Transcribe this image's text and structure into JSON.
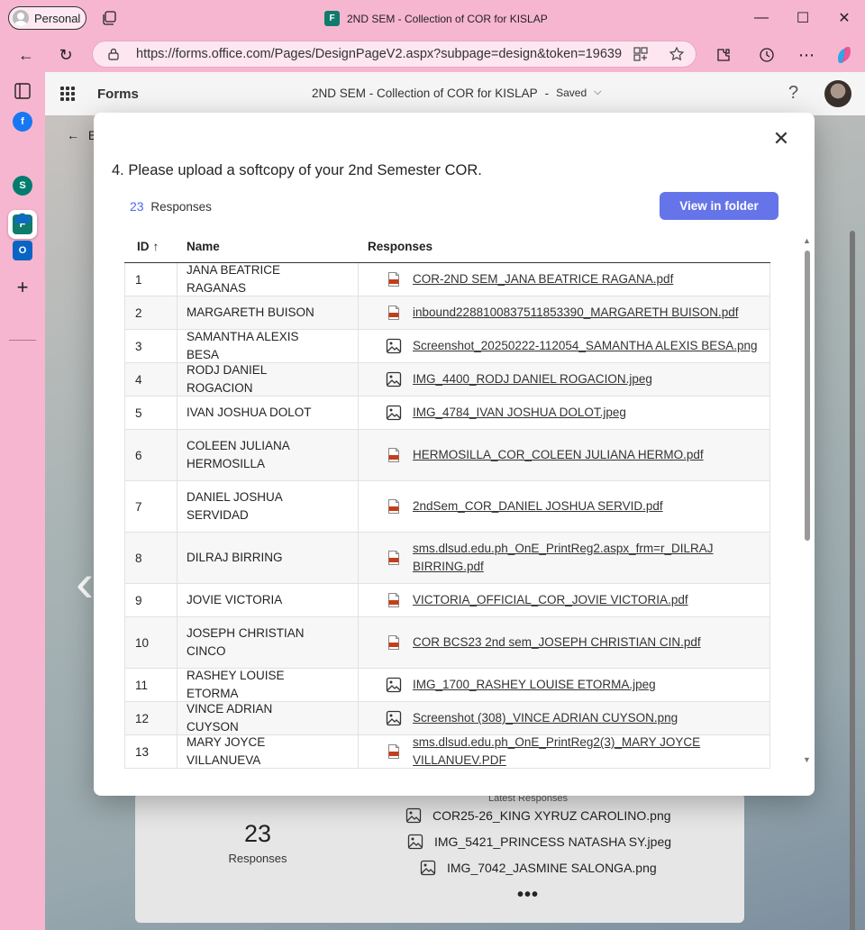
{
  "browser": {
    "profile_label": "Personal",
    "window_title": "2ND SEM - Collection of COR for KISLAP",
    "url": "https://forms.office.com/Pages/DesignPageV2.aspx?subpage=design&token=19639..."
  },
  "forms_header": {
    "app_name": "Forms",
    "doc_title": "2ND SEM - Collection of COR for KISLAP",
    "separator": "-",
    "save_status": "Saved",
    "help_label": "?"
  },
  "background": {
    "back_label": "B",
    "summary": {
      "count": "23",
      "count_label": "Responses",
      "latest_label": "Latest Responses",
      "latest": [
        {
          "file": "COR25-26_KING XYRUZ CAROLINO.png"
        },
        {
          "file": "IMG_5421_PRINCESS NATASHA SY.jpeg"
        },
        {
          "file": "IMG_7042_JASMINE SALONGA.png"
        }
      ],
      "more": "•••"
    }
  },
  "modal": {
    "question": "4. Please upload a softcopy of your 2nd Semester COR.",
    "response_count": "23",
    "response_label": "Responses",
    "view_folder_label": "View in folder",
    "columns": {
      "id": "ID",
      "id_sort": "↑",
      "name": "Name",
      "responses": "Responses"
    },
    "rows": [
      {
        "id": "1",
        "name": "JANA BEATRICE RAGANAS",
        "file": "COR-2ND SEM_JANA BEATRICE RAGANA.pdf",
        "type": "pdf"
      },
      {
        "id": "2",
        "name": "MARGARETH BUISON",
        "file": "inbound2288100837511853390_MARGARETH BUISON.pdf",
        "type": "pdf"
      },
      {
        "id": "3",
        "name": "SAMANTHA ALEXIS BESA",
        "file": "Screenshot_20250222-112054_SAMANTHA ALEXIS BESA.png",
        "type": "image"
      },
      {
        "id": "4",
        "name": "RODJ DANIEL ROGACION",
        "file": "IMG_4400_RODJ DANIEL ROGACION.jpeg",
        "type": "image"
      },
      {
        "id": "5",
        "name": "IVAN JOSHUA DOLOT",
        "file": "IMG_4784_IVAN JOSHUA DOLOT.jpeg",
        "type": "image"
      },
      {
        "id": "6",
        "name": "COLEEN JULIANA HERMOSILLA",
        "file": "HERMOSILLA_COR_COLEEN JULIANA HERMO.pdf",
        "type": "pdf"
      },
      {
        "id": "7",
        "name": "DANIEL JOSHUA SERVIDAD",
        "file": "2ndSem_COR_DANIEL JOSHUA SERVID.pdf",
        "type": "pdf"
      },
      {
        "id": "8",
        "name": "DILRAJ BIRRING",
        "file": "sms.dlsud.edu.ph_OnE_PrintReg2.aspx_frm=r_DILRAJ BIRRING.pdf",
        "type": "pdf"
      },
      {
        "id": "9",
        "name": "JOVIE VICTORIA",
        "file": "VICTORIA_OFFICIAL_COR_JOVIE VICTORIA.pdf",
        "type": "pdf"
      },
      {
        "id": "10",
        "name": "JOSEPH CHRISTIAN CINCO",
        "file": "COR BCS23 2nd sem_JOSEPH CHRISTIAN CIN.pdf",
        "type": "pdf"
      },
      {
        "id": "11",
        "name": "RASHEY LOUISE ETORMA",
        "file": "IMG_1700_RASHEY LOUISE ETORMA.jpeg",
        "type": "image"
      },
      {
        "id": "12",
        "name": "VINCE ADRIAN CUYSON",
        "file": "Screenshot (308)_VINCE ADRIAN CUYSON.png",
        "type": "image"
      },
      {
        "id": "13",
        "name": "MARY JOYCE VILLANUEVA",
        "file": "sms.dlsud.edu.ph_OnE_PrintReg2(3)_MARY JOYCE VILLANUEV.PDF",
        "type": "pdf"
      }
    ]
  },
  "colors": {
    "chrome_pink": "#f7b6cf",
    "accent": "#6574e8",
    "count_blue": "#4f6bed",
    "pdf_red": "#c43e1c"
  }
}
